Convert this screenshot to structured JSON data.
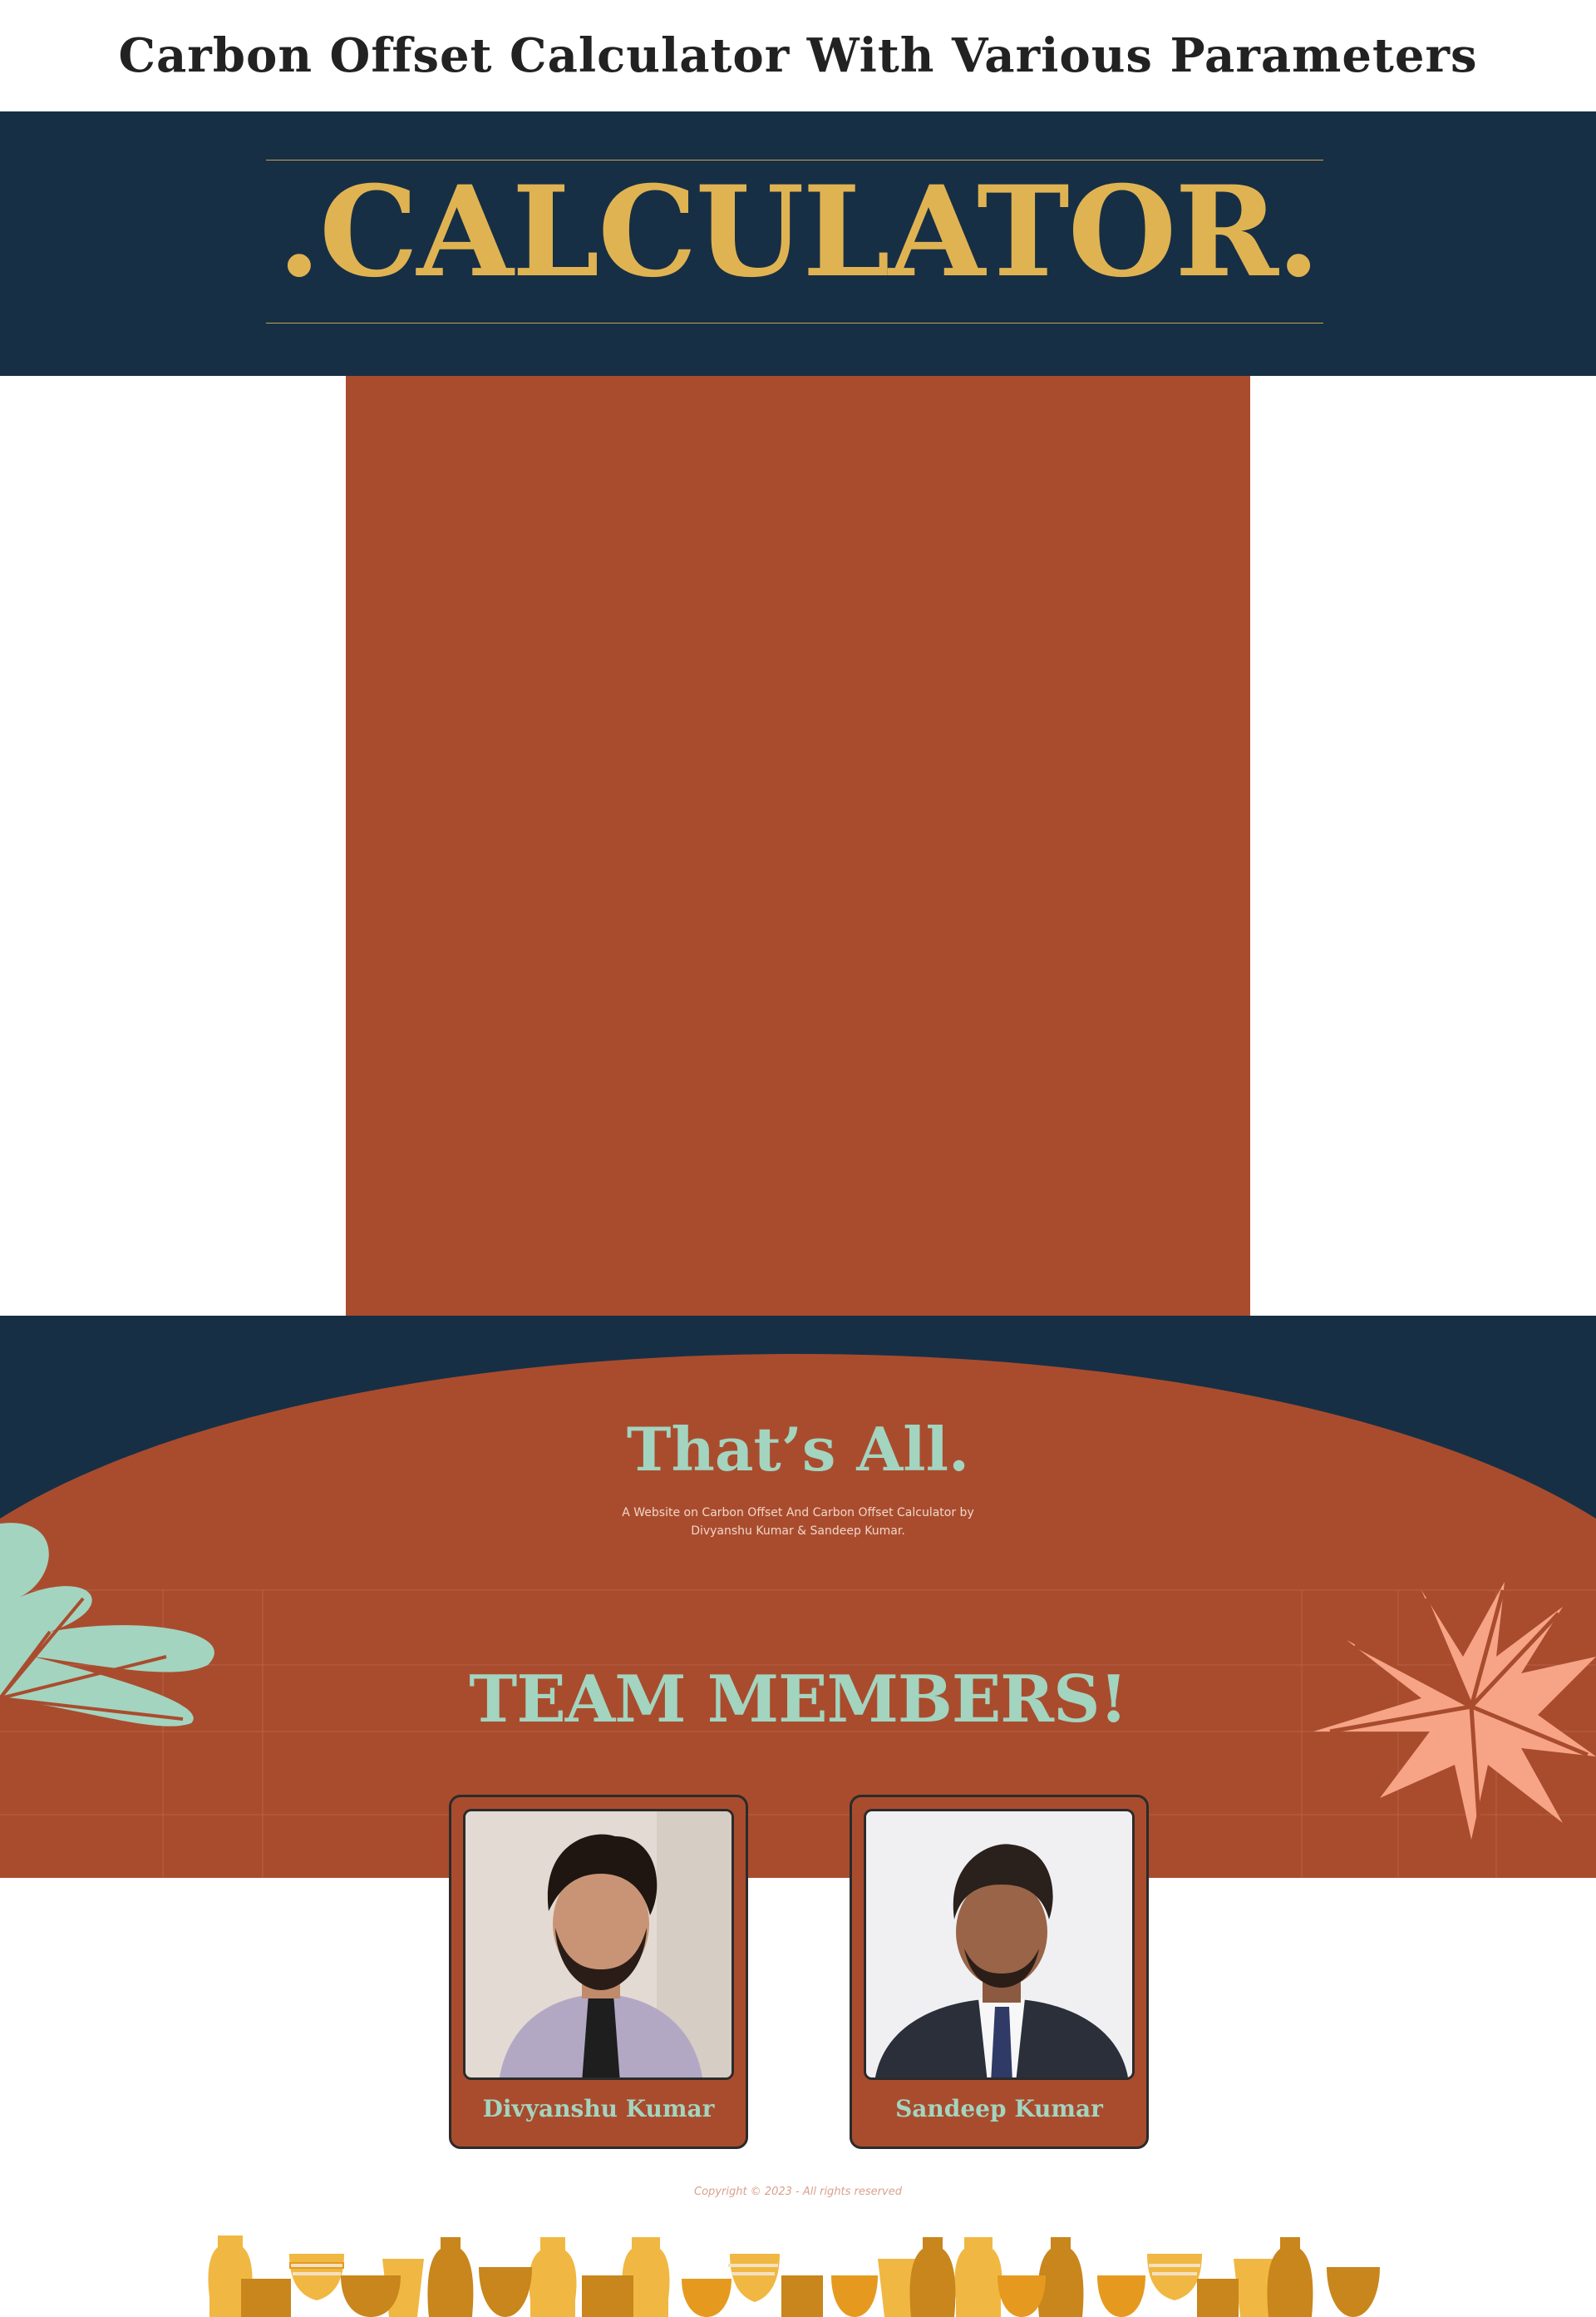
{
  "page": {
    "title": "Carbon Offset Calculator With Various Parameters"
  },
  "calculator": {
    "heading": ".CALCULATOR."
  },
  "footer": {
    "heading": "That’s All.",
    "description_line1": "A Website on Carbon Offset And Carbon Offset Calculator by",
    "description_line2": "Divyanshu Kumar & Sandeep Kumar.",
    "team_heading": "TEAM MEMBERS!",
    "members": [
      {
        "name": "Divyanshu Kumar"
      },
      {
        "name": "Sandeep Kumar"
      }
    ],
    "copyright": "Copyright © 2023 - All rights reserved"
  },
  "colors": {
    "navy": "#172f45",
    "rust": "#a94c2e",
    "gold": "#e0b352",
    "mint": "#a3d4bf",
    "salmon": "#f7a486"
  },
  "icons": [
    "mint-leaf-icon",
    "salmon-leaf-icon",
    "pottery-decoration"
  ]
}
